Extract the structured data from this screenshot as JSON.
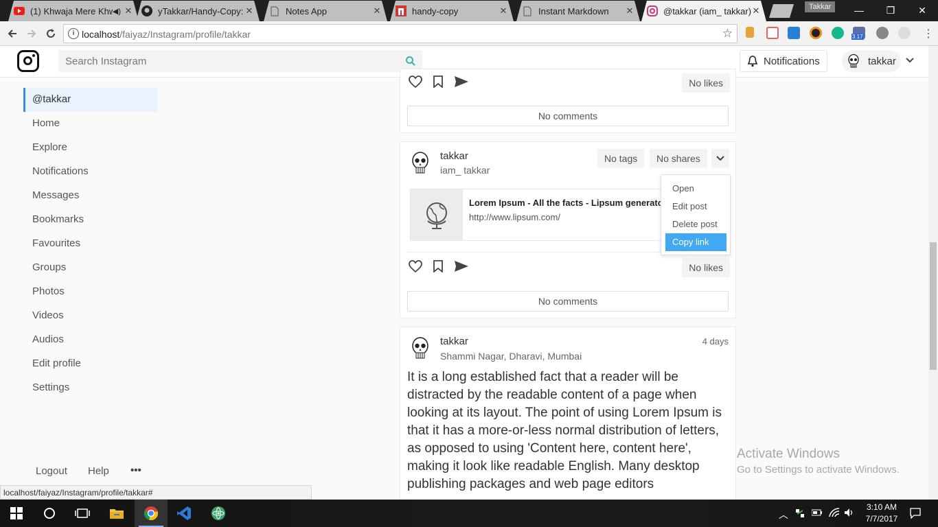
{
  "browser": {
    "tabs": [
      {
        "title": "(1) Khwaja Mere Khwaja",
        "favicon": "youtube-icon",
        "color": "#e62117",
        "active": false
      },
      {
        "title": "yTakkar/Handy-Copy: A",
        "favicon": "github-icon",
        "color": "#222222",
        "active": false
      },
      {
        "title": "Notes App",
        "favicon": "page-icon",
        "color": "#666666",
        "active": false
      },
      {
        "title": "handy-copy",
        "favicon": "npm-icon",
        "color": "#cb3837",
        "active": false
      },
      {
        "title": "Instant Markdown",
        "favicon": "page-icon",
        "color": "#666666",
        "active": false
      },
      {
        "title": "@takkar (iam_ takkar) ·",
        "favicon": "instagram-icon",
        "color": "#c13584",
        "active": true
      }
    ],
    "profile_name": "Takkar",
    "url_host": "localhost",
    "url_path": "/faiyaz/Instagram/profile/takkar",
    "status_url": "localhost/faiyaz/Instagram/profile/takkar#",
    "extension_badge": "3.17"
  },
  "header": {
    "search_placeholder": "Search Instagram",
    "notifications_label": "Notifications",
    "username": "takkar"
  },
  "sidebar": {
    "items": [
      {
        "label": "@takkar",
        "active": true
      },
      {
        "label": "Home"
      },
      {
        "label": "Explore"
      },
      {
        "label": "Notifications"
      },
      {
        "label": "Messages"
      },
      {
        "label": "Bookmarks"
      },
      {
        "label": "Favourites"
      },
      {
        "label": "Groups"
      },
      {
        "label": "Photos"
      },
      {
        "label": "Videos"
      },
      {
        "label": "Audios"
      },
      {
        "label": "Edit profile"
      },
      {
        "label": "Settings"
      }
    ],
    "footer": {
      "logout": "Logout",
      "help": "Help",
      "more": "•••"
    }
  },
  "posts": [
    {
      "likes": "No likes",
      "comments": "No comments"
    },
    {
      "username": "takkar",
      "subtitle": "iam_ takkar",
      "tags": "No tags",
      "shares": "No shares",
      "link_title": "Lorem Ipsum - All the facts - Lipsum generator",
      "link_url": "http://www.lipsum.com/",
      "likes": "No likes",
      "comments": "No comments",
      "menu": {
        "items": [
          "Open",
          "Edit post",
          "Delete post",
          "Copy link"
        ],
        "selected": "Copy link"
      }
    },
    {
      "username": "takkar",
      "subtitle": "Shammi Nagar, Dharavi, Mumbai",
      "time": "4 days",
      "body": "It is a long established fact that a reader will be distracted by the readable content of a page when looking at its layout. The point of using Lorem Ipsum is that it has a more-or-less normal distribution of letters, as opposed to using 'Content here, content here', making it look like readable English. Many desktop publishing packages and web page editors"
    }
  ],
  "watermark": {
    "line1": "Activate Windows",
    "line2": "Go to Settings to activate Windows."
  },
  "taskbar": {
    "time": "3:10 AM",
    "date": "7/7/2017"
  },
  "colors": {
    "accent": "#3c8dde",
    "menu_selected": "#41a9f2",
    "search_icon": "#36b5a8"
  }
}
